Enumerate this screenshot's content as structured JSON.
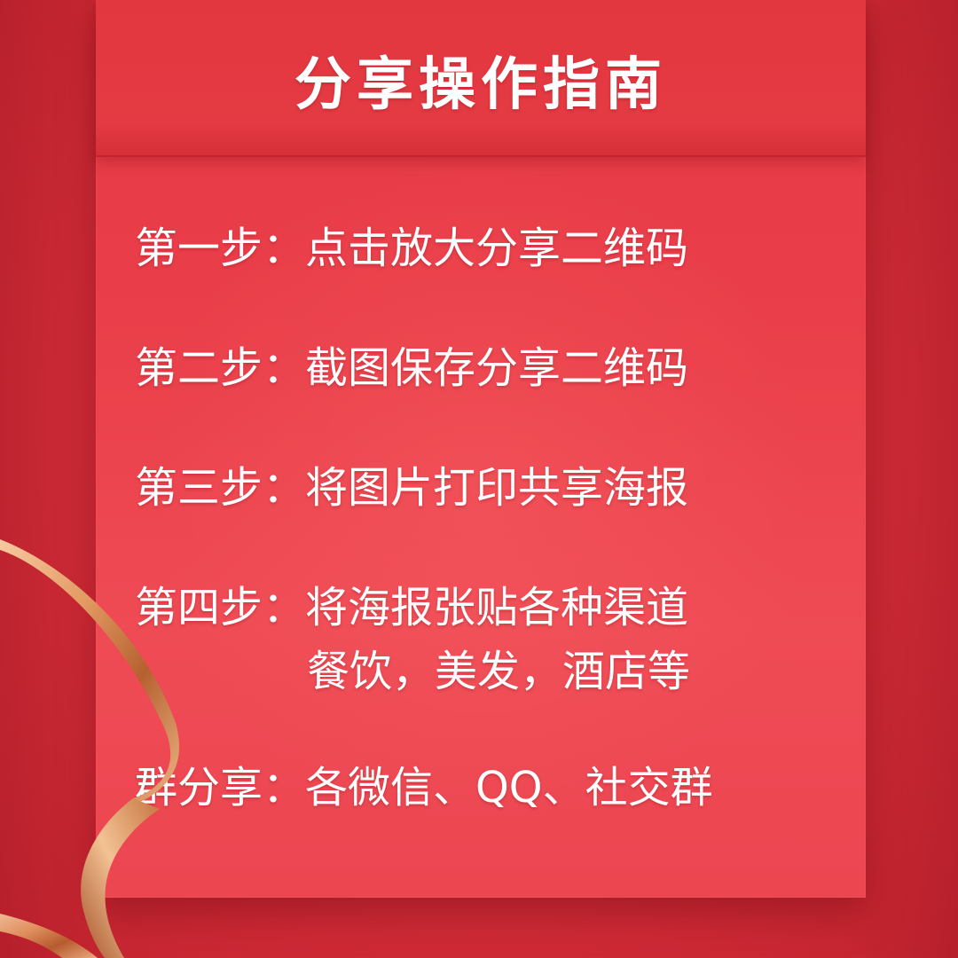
{
  "title": "分享操作指南",
  "steps": [
    {
      "label": "第一步：",
      "text": "点击放大分享二维码"
    },
    {
      "label": "第二步：",
      "text": "截图保存分享二维码"
    },
    {
      "label": "第三步：",
      "text": "将图片打印共享海报"
    },
    {
      "label": "第四步：",
      "text": "将海报张贴各种渠道",
      "text2": "餐饮，美发，酒店等"
    },
    {
      "label": "群分享：",
      "text": "各微信、QQ、社交群"
    }
  ],
  "colors": {
    "background": "#d72f3b",
    "card": "#ea404b",
    "text": "#ffffff",
    "ribbon": "#e8a06a"
  },
  "decorations": {
    "ribbon": "gold-ribbon"
  }
}
